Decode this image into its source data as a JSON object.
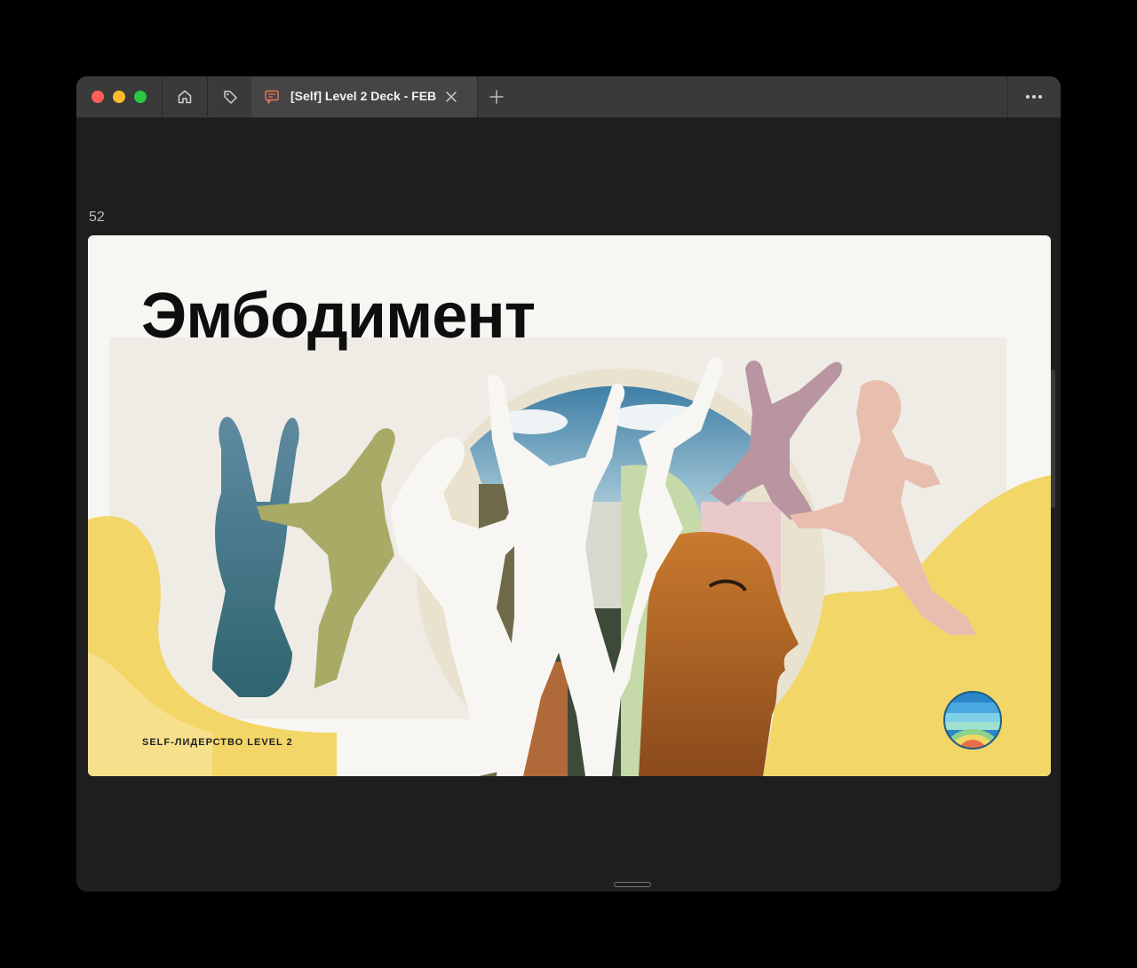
{
  "window": {
    "tab": {
      "title": "[Self] Level 2 Deck - FEB",
      "icon": "presentation-icon"
    },
    "nav_icons": [
      "home-icon",
      "tag-icon"
    ],
    "new_tab_icon": "plus-icon",
    "menu_icon": "more-icon"
  },
  "slide": {
    "number": "52",
    "title": "Эмбодимент",
    "footer": "SELF-ЛИДЕРСТВО LEVEL 2"
  },
  "colors": {
    "titlebar": "#3a3a3a",
    "tab_active": "#454545",
    "window_bg": "#1e1e1e",
    "slide_bg": "#f8f6f2",
    "accent_yellow": "#f3d668",
    "tab_icon": "#e8735a"
  }
}
